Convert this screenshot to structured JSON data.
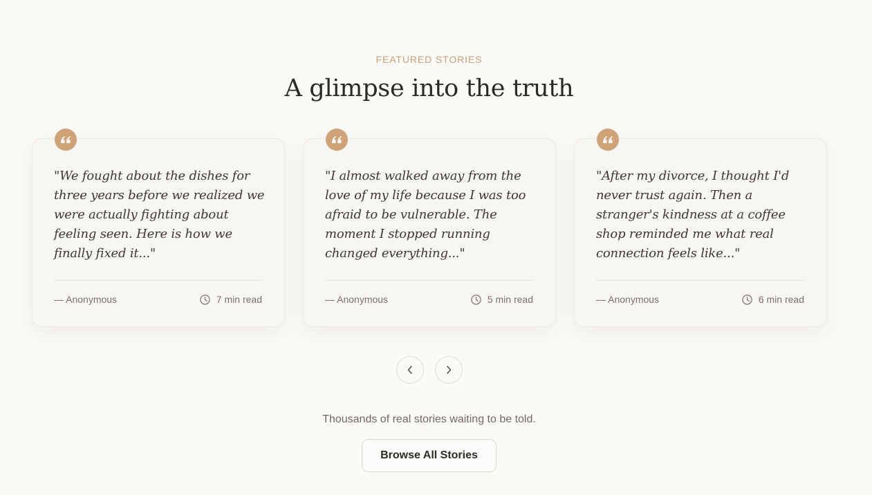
{
  "section": {
    "eyebrow": "FEATURED STORIES",
    "title": "A glimpse into the truth"
  },
  "stories": [
    {
      "quote": "\"We fought about the dishes for three years before we realized we were actually fighting about feeling seen. Here is how we finally fixed it...\"",
      "author": "— Anonymous",
      "read_time": "7 min read"
    },
    {
      "quote": "\"I almost walked away from the love of my life because I was too afraid to be vulnerable. The moment I stopped running changed everything...\"",
      "author": "— Anonymous",
      "read_time": "5 min read"
    },
    {
      "quote": "\"After my divorce, I thought I'd never trust again. Then a stranger's kindness at a coffee shop reminded me what real connection feels like...\"",
      "author": "— Anonymous",
      "read_time": "6 min read"
    }
  ],
  "carousel": {
    "prev_icon": "chevron-left-icon",
    "next_icon": "chevron-right-icon"
  },
  "cta": {
    "tagline": "Thousands of real stories waiting to be told.",
    "button_label": "Browse All Stories"
  },
  "colors": {
    "accent": "#cfa277",
    "background": "#fbfaf7",
    "card": "#f8f6f3"
  }
}
